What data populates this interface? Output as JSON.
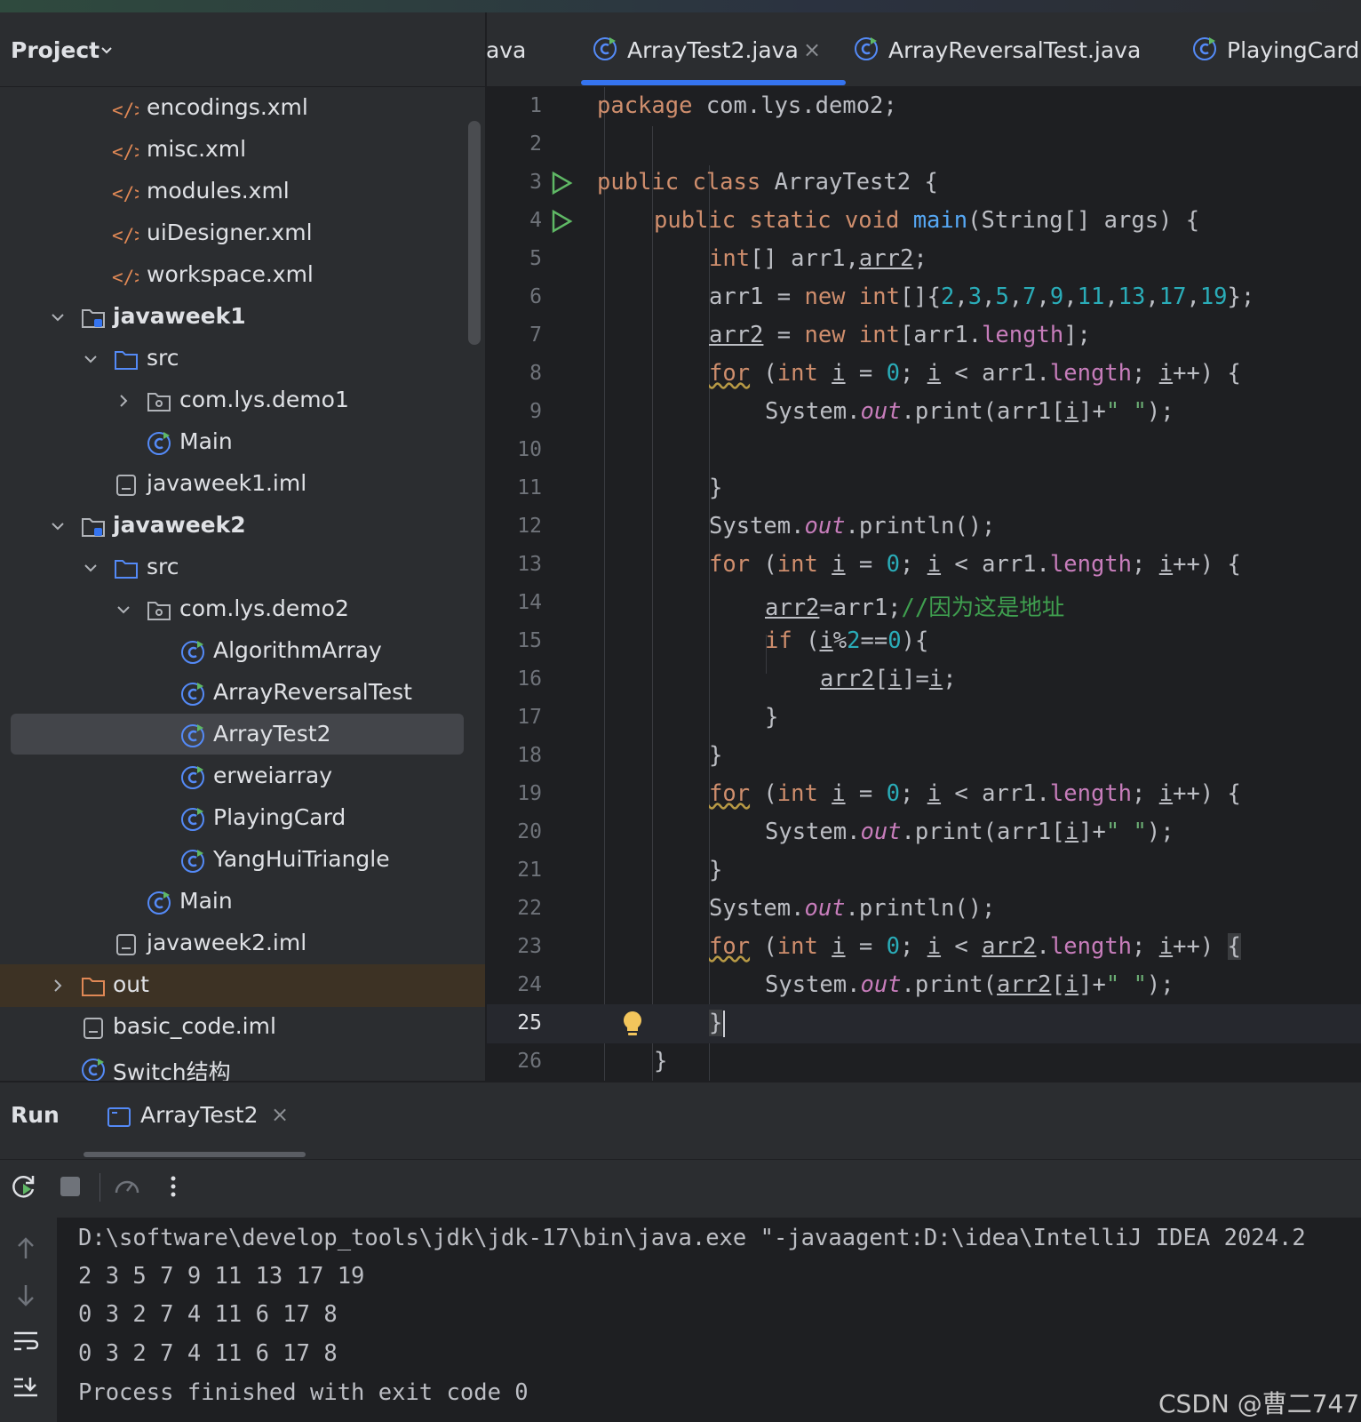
{
  "project": {
    "title": "Project",
    "tree": [
      {
        "label": "encodings.xml",
        "icon": "xml-file-icon"
      },
      {
        "label": "misc.xml",
        "icon": "xml-file-icon"
      },
      {
        "label": "modules.xml",
        "icon": "xml-file-icon"
      },
      {
        "label": "uiDesigner.xml",
        "icon": "xml-file-icon"
      },
      {
        "label": "workspace.xml",
        "icon": "xml-file-icon"
      },
      {
        "label": "javaweek1",
        "icon": "module-folder-icon"
      },
      {
        "label": "src",
        "icon": "source-folder-icon"
      },
      {
        "label": "com.lys.demo1",
        "icon": "package-icon"
      },
      {
        "label": "Main",
        "icon": "java-class-icon"
      },
      {
        "label": "javaweek1.iml",
        "icon": "iml-file-icon"
      },
      {
        "label": "javaweek2",
        "icon": "module-folder-icon"
      },
      {
        "label": "src",
        "icon": "source-folder-icon"
      },
      {
        "label": "com.lys.demo2",
        "icon": "package-icon"
      },
      {
        "label": "AlgorithmArray",
        "icon": "java-class-icon"
      },
      {
        "label": "ArrayReversalTest",
        "icon": "java-class-icon"
      },
      {
        "label": "ArrayTest2",
        "icon": "java-class-icon"
      },
      {
        "label": "erweiarray",
        "icon": "java-class-icon"
      },
      {
        "label": "PlayingCard",
        "icon": "java-class-icon"
      },
      {
        "label": "YangHuiTriangle",
        "icon": "java-class-icon"
      },
      {
        "label": "Main",
        "icon": "java-class-icon"
      },
      {
        "label": "javaweek2.iml",
        "icon": "iml-file-icon"
      },
      {
        "label": "out",
        "icon": "excluded-folder-icon"
      },
      {
        "label": "basic_code.iml",
        "icon": "iml-file-icon"
      },
      {
        "label": "Switch结构",
        "icon": "java-class-icon"
      }
    ]
  },
  "editor": {
    "tabs": [
      {
        "label": "java"
      },
      {
        "label": "ArrayTest2.java",
        "close": "×"
      },
      {
        "label": "ArrayReversalTest.java"
      },
      {
        "label": "PlayingCard.java"
      }
    ],
    "line_numbers": [
      "1",
      "2",
      "3",
      "4",
      "5",
      "6",
      "7",
      "8",
      "9",
      "10",
      "11",
      "12",
      "13",
      "14",
      "15",
      "16",
      "17",
      "18",
      "19",
      "20",
      "21",
      "22",
      "23",
      "24",
      "25",
      "26"
    ]
  },
  "run": {
    "title": "Run",
    "tab_label": "ArrayTest2",
    "tab_close": "×",
    "console": [
      "D:\\software\\develop_tools\\jdk\\jdk-17\\bin\\java.exe \"-javaagent:D:\\idea\\IntelliJ IDEA 2024.2",
      "2 3 5 7 9 11 13 17 19",
      "0 3 2 7 4 11 6 17 8",
      "0 3 2 7 4 11 6 17 8",
      "Process finished with exit code 0"
    ]
  },
  "watermark": "CSDN @曹二747",
  "colors": {
    "accent": "#3574f0",
    "keyword": "#cf8e6d",
    "number": "#2aacb8",
    "string": "#6aab73",
    "method": "#56a8f5",
    "field": "#c77dbb",
    "comment": "#3f9f4f"
  }
}
